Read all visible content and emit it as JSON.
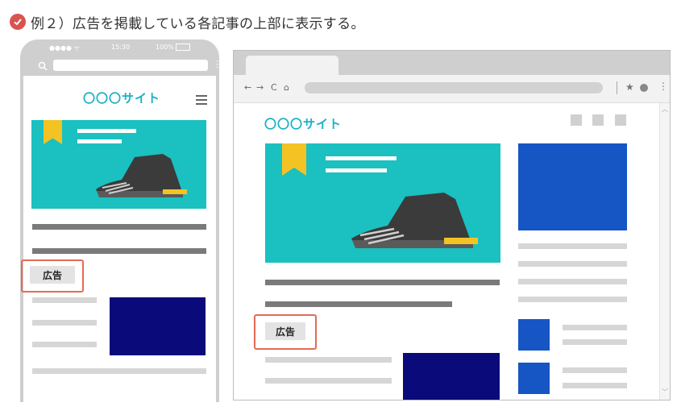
{
  "caption": {
    "text": "例２）広告を掲載している各記事の上部に表示する。"
  },
  "phone": {
    "status": {
      "signal": "●●●● ᯤ",
      "time": "15:30",
      "battery": "100%"
    },
    "site_title": "〇〇〇サイト",
    "ad_label": "広告"
  },
  "browser": {
    "nav": {
      "back": "←",
      "forward": "→",
      "reload": "C",
      "home": "⌂"
    },
    "site_title": "〇〇〇サイト",
    "ad_label": "広告"
  },
  "colors": {
    "accent_teal": "#1bc0c0",
    "title_teal": "#1ab2c3",
    "ad_border": "#e36b55",
    "navy": "#0a0a7a",
    "blue": "#1655c4",
    "ribbon": "#f3c324"
  }
}
